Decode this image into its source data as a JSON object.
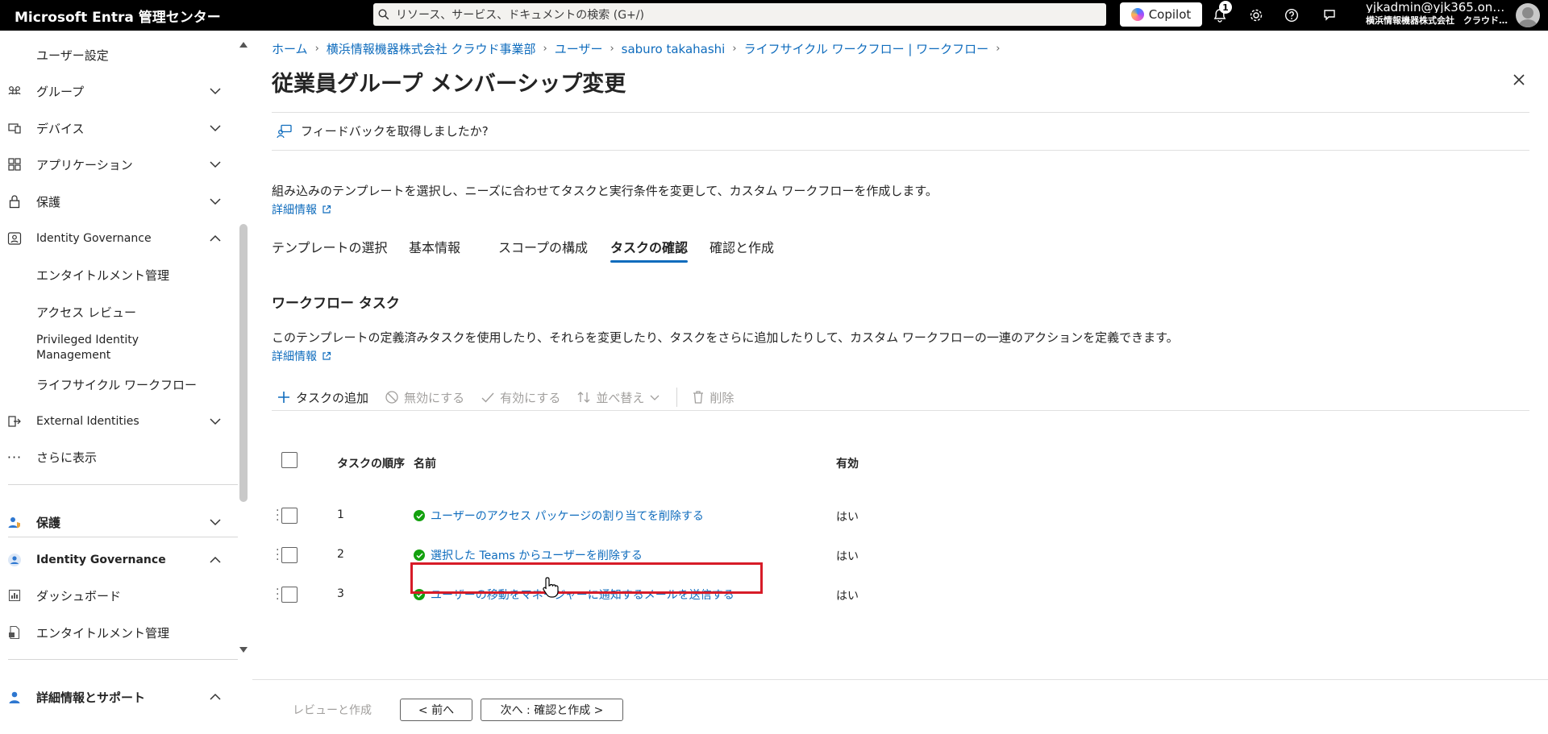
{
  "topbar": {
    "brand": "Microsoft Entra 管理センター",
    "search_placeholder": "リソース、サービス、ドキュメントの検索 (G+/)",
    "copilot_label": "Copilot",
    "notification_count": "1",
    "account_user": "yjkadmin@yjk365.on…",
    "account_org": "横浜情報機器株式会社　クラウド…"
  },
  "sidebar": {
    "items": [
      {
        "label": "ユーザー設定"
      },
      {
        "label": "グループ"
      },
      {
        "label": "デバイス"
      },
      {
        "label": "アプリケーション"
      },
      {
        "label": "保護"
      },
      {
        "label": "Identity Governance"
      },
      {
        "label": "エンタイトルメント管理"
      },
      {
        "label": "アクセス レビュー"
      },
      {
        "label": "Privileged Identity Management"
      },
      {
        "label": "ライフサイクル ワークフロー"
      },
      {
        "label": "External Identities"
      },
      {
        "label": "さらに表示"
      },
      {
        "label": "保護"
      },
      {
        "label": "Identity Governance"
      },
      {
        "label": "ダッシュボード"
      },
      {
        "label": "エンタイトルメント管理"
      },
      {
        "label": "詳細情報とサポート"
      }
    ],
    "collapse_glyph": "«"
  },
  "breadcrumb": [
    "ホーム",
    "横浜情報機器株式会社 クラウド事業部",
    "ユーザー",
    "saburo takahashi",
    "ライフサイクル ワークフロー | ワークフロー"
  ],
  "page": {
    "title": "従業員グループ メンバーシップ変更",
    "ellipsis": "…",
    "feedback": "フィードバックを取得しましたか?",
    "description": "組み込みのテンプレートを選択し、ニーズに合わせてタスクと実行条件を変更して、カスタム ワークフローを作成します。",
    "more_info": "詳細情報"
  },
  "tabs": [
    {
      "label": "テンプレートの選択"
    },
    {
      "label": "基本情報"
    },
    {
      "label": "スコープの構成"
    },
    {
      "label": "タスクの確認"
    },
    {
      "label": "確認と作成"
    }
  ],
  "tasks_section": {
    "title": "ワークフロー タスク",
    "description": "このテンプレートの定義済みタスクを使用したり、それらを変更したり、タスクをさらに追加したりして、カスタム ワークフローの一連のアクションを定義できます。",
    "more_info": "詳細情報"
  },
  "toolbar": {
    "add": "タスクの追加",
    "disable": "無効にする",
    "enable": "有効にする",
    "sort": "並べ替え",
    "delete": "削除"
  },
  "table": {
    "headers": [
      "タスクの順序",
      "名前",
      "有効"
    ],
    "rows": [
      {
        "order": "1",
        "name": "ユーザーのアクセス パッケージの割り当てを削除する",
        "enabled": "はい"
      },
      {
        "order": "2",
        "name": "選択した Teams からユーザーを削除する",
        "enabled": "はい"
      },
      {
        "order": "3",
        "name": "ユーザーの移動をマネージャーに通知するメールを送信する",
        "enabled": "はい"
      }
    ]
  },
  "footer": {
    "review": "レビューと作成",
    "prev": "< 前へ",
    "next": "次へ : 確認と作成 >"
  },
  "colors": {
    "accent": "#0f6cbd",
    "highlight": "#d71c28",
    "success": "#13a10e"
  }
}
